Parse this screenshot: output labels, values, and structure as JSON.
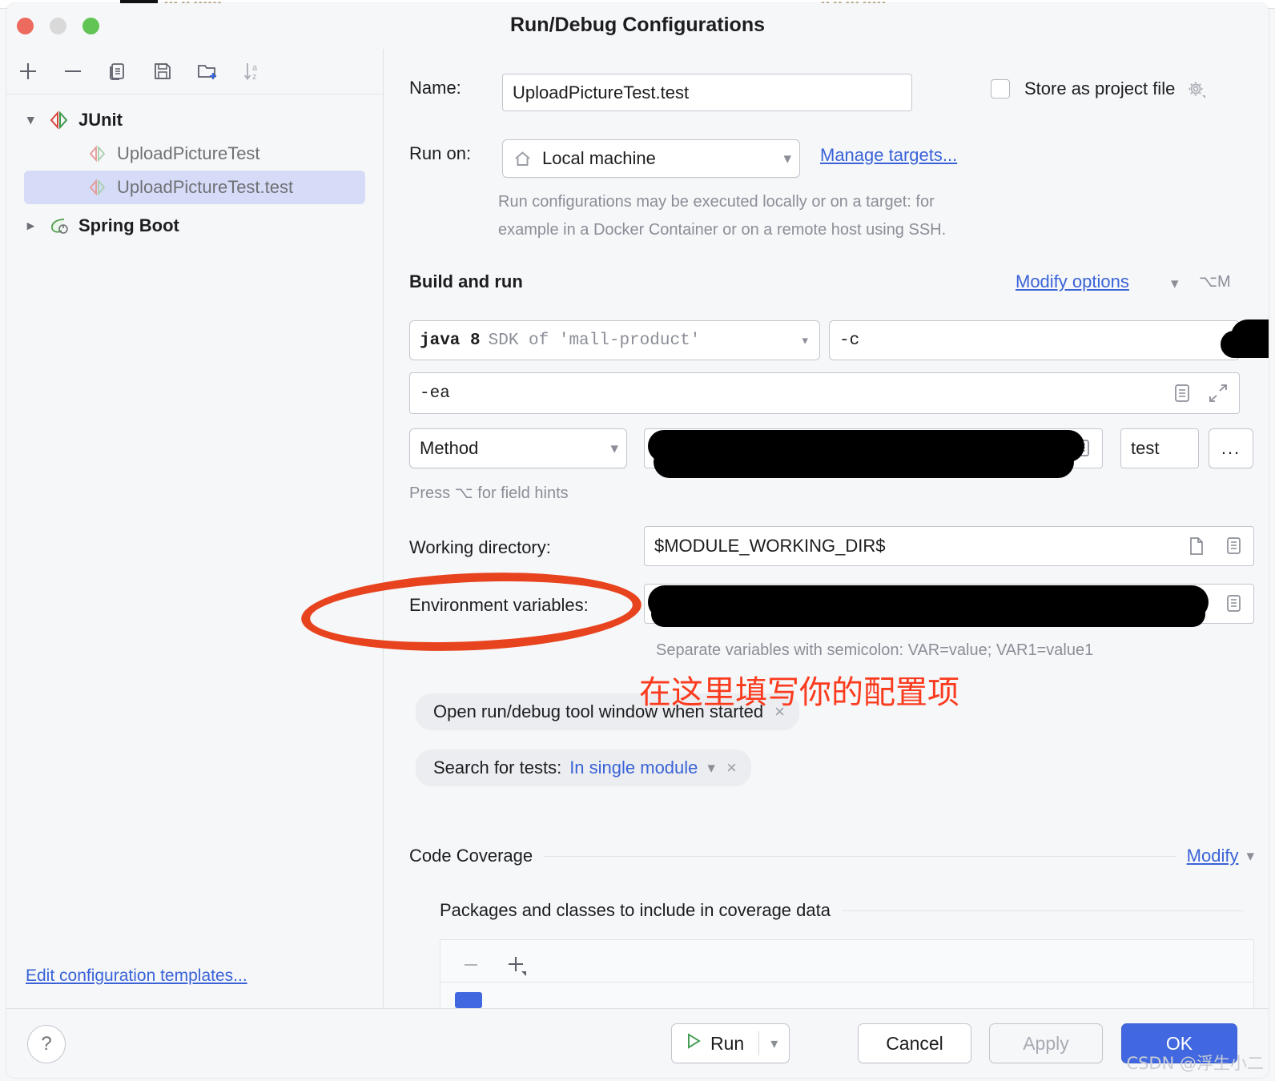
{
  "window": {
    "title": "Run/Debug Configurations",
    "traffic_lights": [
      "close",
      "minimize",
      "zoom"
    ]
  },
  "left_panel": {
    "toolbar": [
      {
        "name": "add-configuration-button",
        "icon": "plus-icon"
      },
      {
        "name": "remove-configuration-button",
        "icon": "minus-icon"
      },
      {
        "name": "copy-configuration-button",
        "icon": "copy-icon"
      },
      {
        "name": "save-configuration-button",
        "icon": "save-icon"
      },
      {
        "name": "new-folder-button",
        "icon": "folder-plus-icon"
      },
      {
        "name": "sort-configurations-button",
        "icon": "sort-az-icon"
      }
    ],
    "tree": [
      {
        "label": "JUnit",
        "level": 1,
        "expanded": true,
        "icon": "junit-icon",
        "selected": false
      },
      {
        "label": "UploadPictureTest",
        "level": 2,
        "icon": "junit-run-icon",
        "selected": false
      },
      {
        "label": "UploadPictureTest.test",
        "level": 2,
        "icon": "junit-run-icon",
        "selected": true
      },
      {
        "label": "Spring Boot",
        "level": 1,
        "expanded": false,
        "icon": "spring-boot-icon",
        "selected": false
      }
    ],
    "edit_templates_link": "Edit configuration templates..."
  },
  "form": {
    "name_label": "Name:",
    "name_value": "UploadPictureTest.test",
    "store_as_project_file_label": "Store as project file",
    "store_as_project_file_checked": false,
    "run_on_label": "Run on:",
    "run_on_value": "Local machine",
    "manage_targets_link": "Manage targets...",
    "run_on_description_line1": "Run configurations may be executed locally or on a target: for",
    "run_on_description_line2": "example in a Docker Container or on a remote host using SSH.",
    "build_and_run_title": "Build and run",
    "modify_options_link": "Modify options",
    "modify_options_shortcut": "⌥M",
    "jre_value_prefix": "java 8",
    "jre_value_suffix": "SDK of 'mall-product'",
    "module_value": "-c",
    "module_value_redacted": true,
    "vm_options_value": "-ea",
    "target_kind_value": "Method",
    "class_value_redacted": true,
    "method_value": "test",
    "more_button_label": "...",
    "field_hints_text": "Press ⌥ for field hints",
    "working_directory_label": "Working directory:",
    "working_directory_value": "$MODULE_WORKING_DIR$",
    "environment_variables_label": "Environment variables:",
    "environment_variables_value_redacted": true,
    "environment_variables_hint": "Separate variables with semicolon: VAR=value; VAR1=value1",
    "chips": [
      {
        "text": "Open run/debug tool window when started",
        "link": null,
        "close": "×"
      },
      {
        "text": "Search for tests:",
        "link": "In single module",
        "close": "×",
        "caret": true
      }
    ]
  },
  "code_coverage": {
    "title": "Code Coverage",
    "modify_link": "Modify",
    "packages_title": "Packages and classes to include in coverage data",
    "toolbar": [
      {
        "name": "remove-package-button",
        "icon": "minus-icon"
      },
      {
        "name": "add-package-button",
        "icon": "plus-dropdown-icon"
      }
    ]
  },
  "bottom_bar": {
    "help_label": "?",
    "run_label": "Run",
    "cancel_label": "Cancel",
    "apply_label": "Apply",
    "apply_enabled": false,
    "ok_label": "OK"
  },
  "annotations": {
    "chinese_note": "在这里填写你的配置项",
    "ellipse_target": "environment-variables-label",
    "annotation_color": "#e8431f"
  },
  "watermark": "CSDN @浮生小二",
  "colors": {
    "accent_blue": "#3a63d8",
    "primary_button": "#4168e0",
    "selection": "#d6dcf8",
    "annotation_red": "#e8431f",
    "note_red": "#fb3b1e"
  }
}
